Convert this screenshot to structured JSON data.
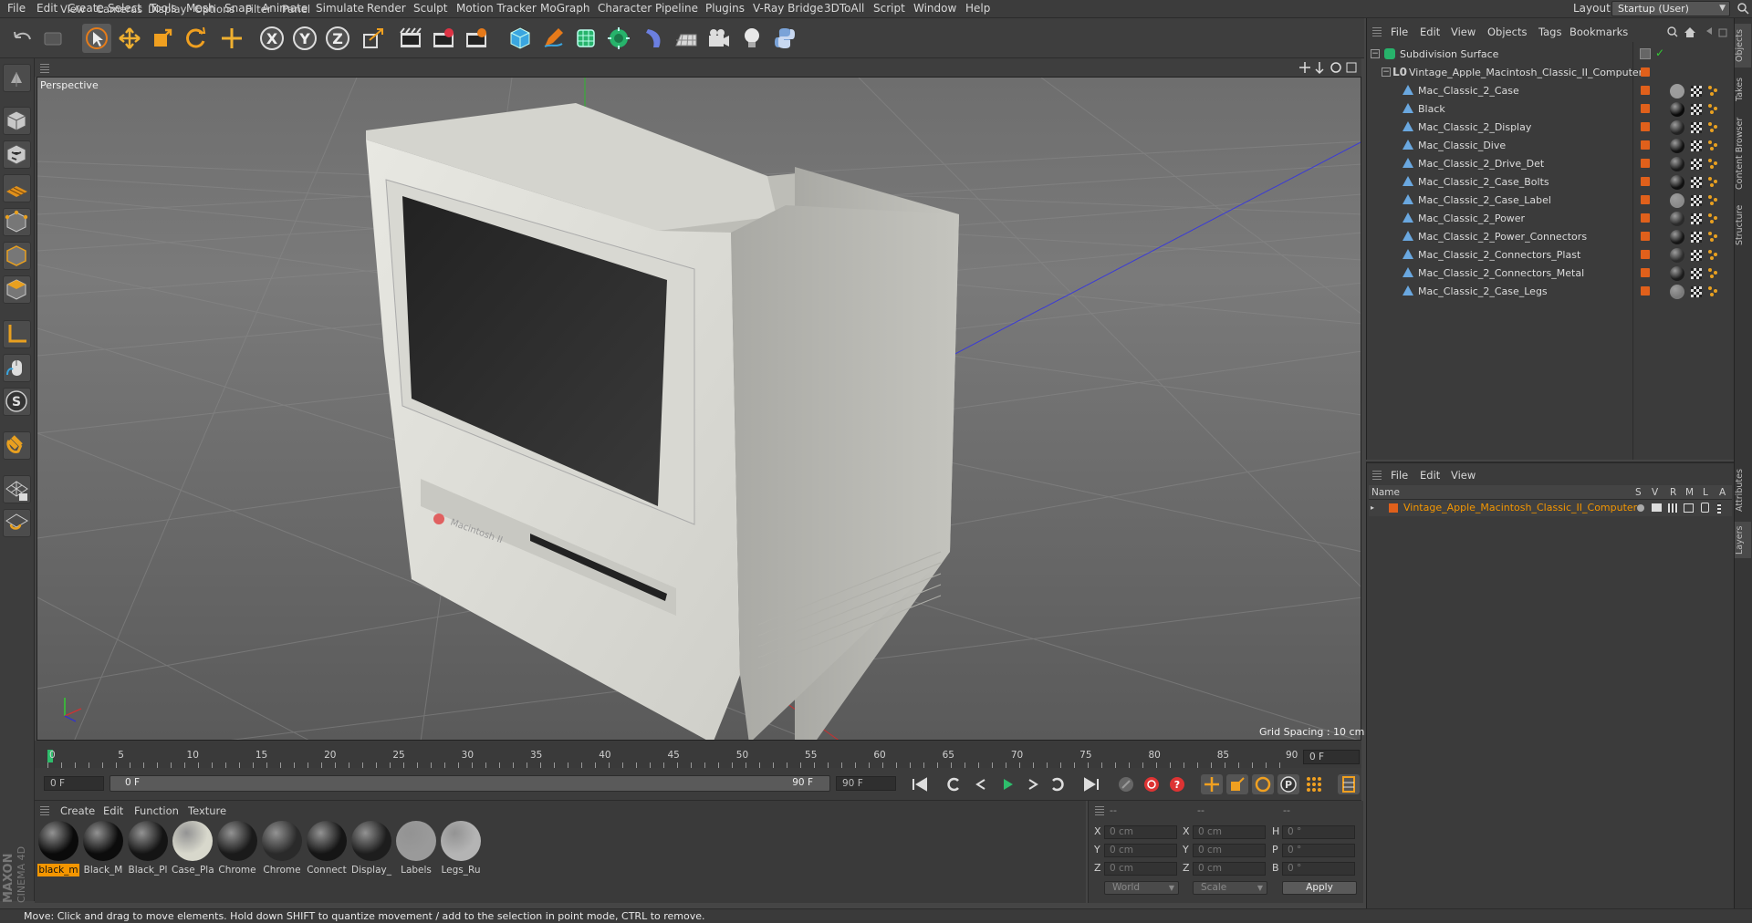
{
  "menubar": {
    "items": [
      "File",
      "Edit",
      "Create",
      "Select",
      "Tools",
      "Mesh",
      "Snap",
      "Animate",
      "Simulate",
      "Render",
      "Sculpt",
      "Motion Tracker",
      "MoGraph",
      "Character",
      "Pipeline",
      "Plugins",
      "V-Ray Bridge",
      "3DToAll",
      "Script",
      "Window",
      "Help"
    ],
    "layout_label": "Layout:",
    "layout_value": "Startup (User)"
  },
  "toolbar": {
    "icons": [
      "undo-icon",
      "redo-icon",
      "live-selection-icon",
      "move-icon",
      "scale-icon",
      "rotate-icon",
      "add-icon",
      "x-axis-icon",
      "y-axis-icon",
      "z-axis-icon",
      "coordinate-system-icon",
      "render-view-icon",
      "render-picture-viewer-icon",
      "edit-render-settings-icon",
      "cube-icon",
      "pen-icon",
      "subdivision-icon",
      "array-icon",
      "deformer-icon",
      "floor-icon",
      "camera-icon",
      "light-icon",
      "python-icon"
    ],
    "axis_labels": [
      "X",
      "Y",
      "Z"
    ]
  },
  "viewport": {
    "menus": [
      "View",
      "Cameras",
      "Display",
      "Options",
      "Filter",
      "Panel"
    ],
    "label": "Perspective",
    "grid_spacing": "Grid Spacing : 10 cm"
  },
  "timeline": {
    "ticks": [
      "0",
      "5",
      "10",
      "15",
      "20",
      "25",
      "30",
      "35",
      "40",
      "45",
      "50",
      "55",
      "60",
      "65",
      "70",
      "75",
      "80",
      "85",
      "90"
    ],
    "current_frame": "0 F"
  },
  "transport": {
    "start_field": "0 F",
    "range_start": "0 F",
    "range_end": "90 F",
    "end_field": "90 F"
  },
  "material_manager": {
    "menus": [
      "Create",
      "Edit",
      "Function",
      "Texture"
    ],
    "materials": [
      {
        "name": "black_m",
        "color": "#0a0a0a",
        "selected": true
      },
      {
        "name": "Black_M",
        "color": "#0c0c0c",
        "selected": false
      },
      {
        "name": "Black_Pl",
        "color": "#141414",
        "selected": false
      },
      {
        "name": "Case_Pla",
        "color": "#d8d8cc",
        "selected": false
      },
      {
        "name": "Chrome",
        "color": "#1a1a1a",
        "selected": false
      },
      {
        "name": "Chrome",
        "color": "#2a2a2a",
        "selected": false
      },
      {
        "name": "Connect",
        "color": "#151515",
        "selected": false
      },
      {
        "name": "Display_",
        "color": "#1d1d1d",
        "selected": false
      },
      {
        "name": "Labels",
        "color": "#9a9a9a",
        "selected": false
      },
      {
        "name": "Legs_Ru",
        "color": "#b4b4b4",
        "selected": false
      }
    ],
    "brand_top": "MAXON",
    "brand_bottom": "CINEMA 4D"
  },
  "coordinates": {
    "header": [
      "--",
      "--",
      "--"
    ],
    "rows": [
      {
        "l1": "X",
        "v1": "0 cm",
        "l2": "X",
        "v2": "0 cm",
        "l3": "H",
        "v3": "0 °"
      },
      {
        "l1": "Y",
        "v1": "0 cm",
        "l2": "Y",
        "v2": "0 cm",
        "l3": "P",
        "v3": "0 °"
      },
      {
        "l1": "Z",
        "v1": "0 cm",
        "l2": "Z",
        "v2": "0 cm",
        "l3": "B",
        "v3": "0 °"
      }
    ],
    "mode_world": "World",
    "mode_scale": "Scale",
    "apply": "Apply"
  },
  "object_manager": {
    "menus": [
      "File",
      "Edit",
      "View",
      "Objects",
      "Tags",
      "Bookmarks"
    ],
    "root": "Subdivision Surface",
    "group": "Vintage_Apple_Macintosh_Classic_II_Computer",
    "children": [
      {
        "name": "Mac_Classic_2_Case",
        "ball": "#9a9a9a"
      },
      {
        "name": "Black",
        "ball": "#0a0a0a"
      },
      {
        "name": "Mac_Classic_2_Display",
        "ball": "#222222"
      },
      {
        "name": "Mac_Classic_Dive",
        "ball": "#111111"
      },
      {
        "name": "Mac_Classic_2_Drive_Det",
        "ball": "#1a1a1a"
      },
      {
        "name": "Mac_Classic_2_Case_Bolts",
        "ball": "#111111"
      },
      {
        "name": "Mac_Classic_2_Case_Label",
        "ball": "#8a8a8a"
      },
      {
        "name": "Mac_Classic_2_Power",
        "ball": "#2a2a2a"
      },
      {
        "name": "Mac_Classic_2_Power_Connectors",
        "ball": "#151515"
      },
      {
        "name": "Mac_Classic_2_Connectors_Plast",
        "ball": "#2c2c2c"
      },
      {
        "name": "Mac_Classic_2_Connectors_Metal",
        "ball": "#1c1c1c"
      },
      {
        "name": "Mac_Classic_2_Case_Legs",
        "ball": "#7a7a7a"
      }
    ]
  },
  "layer_manager": {
    "menus": [
      "File",
      "Edit",
      "View"
    ],
    "columns": [
      "Name",
      "S",
      "V",
      "R",
      "M",
      "L",
      "A"
    ],
    "layer_name": "Vintage_Apple_Macintosh_Classic_II_Computer",
    "layer_color": "#e0601b"
  },
  "side_tabs": [
    "Objects",
    "Takes",
    "Content Browser",
    "Structure",
    "Attributes",
    "Layers"
  ],
  "status": "Move: Click and drag to move elements. Hold down SHIFT to quantize movement / add to the selection in point mode, CTRL to remove.",
  "colors": {
    "accent": "#f49600",
    "timeline_marker": "#2ebd6b"
  }
}
